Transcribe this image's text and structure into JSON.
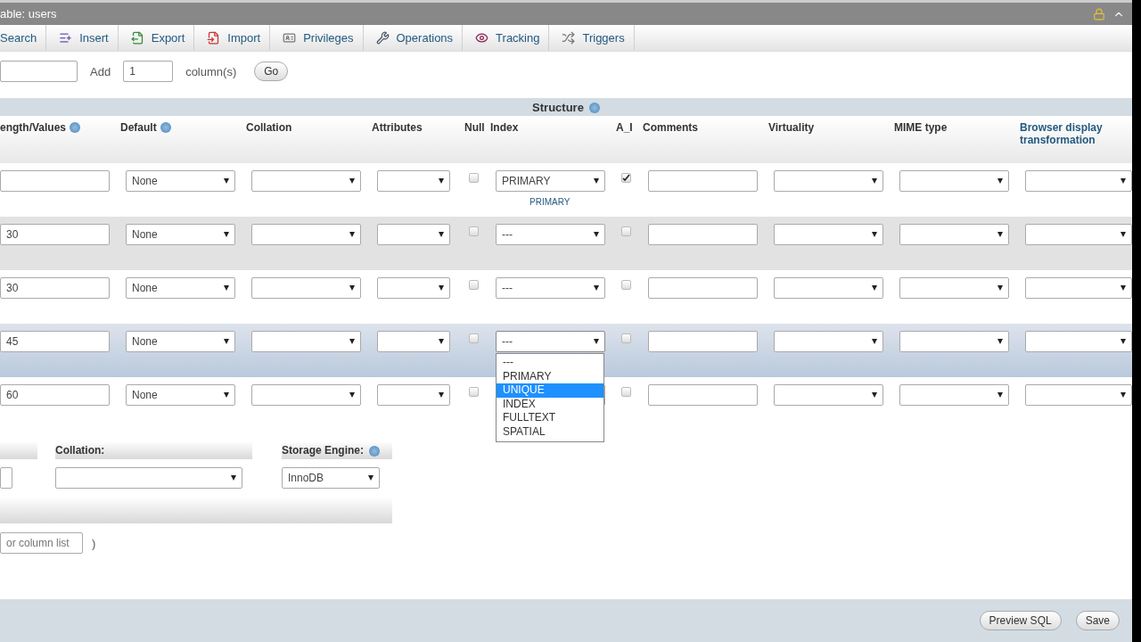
{
  "title_bar": {
    "title": "able: users"
  },
  "tabs": [
    {
      "label": "Search"
    },
    {
      "label": "Insert"
    },
    {
      "label": "Export"
    },
    {
      "label": "Import"
    },
    {
      "label": "Privileges"
    },
    {
      "label": "Operations"
    },
    {
      "label": "Tracking"
    },
    {
      "label": "Triggers"
    }
  ],
  "add_columns": {
    "label": "Add",
    "count": "1",
    "unit": "column(s)",
    "button": "Go"
  },
  "structure": {
    "title": "Structure",
    "columns": [
      {
        "label": "ength/Values",
        "help": true,
        "link": false
      },
      {
        "label": "Default",
        "help": true,
        "link": false
      },
      {
        "label": "Collation",
        "help": false,
        "link": false
      },
      {
        "label": "Attributes",
        "help": false,
        "link": false
      },
      {
        "label": "Null",
        "help": false,
        "link": false
      },
      {
        "label": "Index",
        "help": false,
        "link": false
      },
      {
        "label": "A_I",
        "help": false,
        "link": false
      },
      {
        "label": "Comments",
        "help": false,
        "link": false
      },
      {
        "label": "Virtuality",
        "help": false,
        "link": false
      },
      {
        "label": "MIME type",
        "help": false,
        "link": false
      },
      {
        "label": "Browser display transformation",
        "help": false,
        "link": true
      }
    ],
    "rows": [
      {
        "length": "",
        "default": "None",
        "index": "PRIMARY",
        "index_note": "PRIMARY",
        "null": false,
        "auto_increment": true,
        "highlighted": false,
        "index_open": false
      },
      {
        "length": "30",
        "default": "None",
        "index": "---",
        "null": false,
        "auto_increment": false,
        "highlighted": false,
        "index_open": false
      },
      {
        "length": "30",
        "default": "None",
        "index": "---",
        "null": false,
        "auto_increment": false,
        "highlighted": false,
        "index_open": false
      },
      {
        "length": "45",
        "default": "None",
        "index": "---",
        "null": false,
        "auto_increment": false,
        "highlighted": true,
        "index_open": true
      },
      {
        "length": "60",
        "default": "None",
        "null": false,
        "auto_increment": false,
        "highlighted": false,
        "index_open": false
      }
    ],
    "index_options": [
      {
        "label": "---",
        "selected": false
      },
      {
        "label": "PRIMARY",
        "selected": false
      },
      {
        "label": "UNIQUE",
        "selected": true
      },
      {
        "label": "INDEX",
        "selected": false
      },
      {
        "label": "FULLTEXT",
        "selected": false
      },
      {
        "label": "SPATIAL",
        "selected": false
      }
    ]
  },
  "table_options": {
    "collation_label": "Collation:",
    "engine_label": "Storage Engine:",
    "engine": "InnoDB"
  },
  "partition": {
    "placeholder": "or column list",
    "suffix": ")"
  },
  "footer": {
    "buttons": [
      "Preview SQL",
      "Save"
    ]
  }
}
